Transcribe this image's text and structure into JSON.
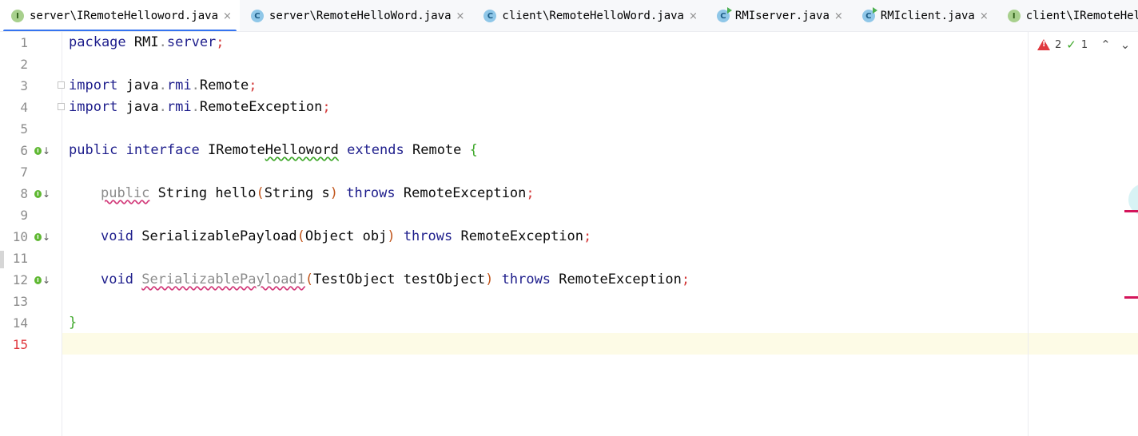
{
  "tabs": [
    {
      "label": "server\\IRemoteHelloword.java",
      "icon": "interface-icon",
      "active": true
    },
    {
      "label": "server\\RemoteHelloWord.java",
      "icon": "class-icon"
    },
    {
      "label": "client\\RemoteHelloWord.java",
      "icon": "class-icon"
    },
    {
      "label": "RMIserver.java",
      "icon": "runnable-class-icon"
    },
    {
      "label": "RMIclient.java",
      "icon": "runnable-class-icon"
    },
    {
      "label": "client\\IRemoteHellowo",
      "icon": "interface-icon"
    }
  ],
  "tab_icon_letters": {
    "interface": "I",
    "class": "C"
  },
  "close_glyph": "×",
  "inspections": {
    "errors": "2",
    "warnings": "1"
  },
  "line_numbers": [
    "1",
    "2",
    "3",
    "4",
    "5",
    "6",
    "7",
    "8",
    "9",
    "10",
    "11",
    "12",
    "13",
    "14",
    "15"
  ],
  "current_line": "15",
  "code": {
    "l1": {
      "kw": "package",
      "pkg1": "RMI",
      "dot": ".",
      "pkg2": "server",
      "semi": ";"
    },
    "l3": {
      "kw": "import",
      "p1": "java",
      "d1": ".",
      "p2": "rmi",
      "d2": ".",
      "name": "Remote",
      "semi": ";"
    },
    "l4": {
      "kw": "import",
      "p1": "java",
      "d1": ".",
      "p2": "rmi",
      "d2": ".",
      "name": "RemoteException",
      "semi": ";"
    },
    "l6": {
      "kw1": "public",
      "kw2": "interface",
      "n1": "IRemote",
      "n2": "Helloword",
      "kw3": "extends",
      "parent": "Remote",
      "brace": "{"
    },
    "l8": {
      "mod": "public",
      "type": "String",
      "method": "hello",
      "op": "(",
      "ptype": "String",
      "pname": "s",
      "cp": ")",
      "kw": "throws",
      "ex": "RemoteException",
      "semi": ";"
    },
    "l10": {
      "type": "void",
      "method": "SerializablePayload",
      "op": "(",
      "ptype": "Object",
      "pname": "obj",
      "cp": ")",
      "kw": "throws",
      "ex": "RemoteException",
      "semi": ";"
    },
    "l12": {
      "type": "void",
      "method": "SerializablePayload1",
      "op": "(",
      "ptype": "TestObject",
      "pname": "testObject",
      "cp": ")",
      "kw": "throws",
      "ex": "RemoteException",
      "semi": ";"
    },
    "l14": {
      "brace": "}"
    }
  },
  "colors": {
    "accent": "#3574f0",
    "error": "#e0383e",
    "error_stripe": "#d4145a",
    "interface_icon": "#a8d08d",
    "class_icon": "#8fc7e8",
    "brace": "#3fa82b"
  }
}
